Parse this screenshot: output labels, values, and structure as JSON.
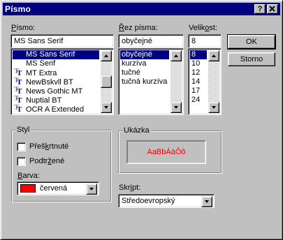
{
  "window": {
    "title": "Písmo",
    "help_button": "?",
    "close_button": "✕"
  },
  "font": {
    "label_u": "P",
    "label_rest": "ísmo:",
    "value": "MS Sans Serif",
    "items": [
      {
        "label": "MS Sans Serif",
        "icon": "none",
        "selected": true
      },
      {
        "label": "MS Serif",
        "icon": "none",
        "selected": false
      },
      {
        "label": "MT Extra",
        "icon": "truetype-icon",
        "selected": false
      },
      {
        "label": "NewBskvll BT",
        "icon": "truetype-icon",
        "selected": false
      },
      {
        "label": "News Gothic MT",
        "icon": "truetype-icon",
        "selected": false
      },
      {
        "label": "Nuptial BT",
        "icon": "truetype-icon",
        "selected": false
      },
      {
        "label": "OCR A Extended",
        "icon": "truetype-icon",
        "selected": false
      }
    ]
  },
  "style": {
    "label_u": "Ř",
    "label_rest": "ez písma:",
    "value": "obyčejné",
    "items": [
      {
        "label": "obyčejné",
        "selected": true
      },
      {
        "label": "kurzíva",
        "selected": false
      },
      {
        "label": "tučné",
        "selected": false
      },
      {
        "label": "tučná kurzíva",
        "selected": false
      }
    ]
  },
  "size": {
    "label_rest": "Velikost:",
    "value": "8",
    "items": [
      {
        "label": "8",
        "selected": true
      },
      {
        "label": "10",
        "selected": false
      },
      {
        "label": "12",
        "selected": false
      },
      {
        "label": "14",
        "selected": false
      },
      {
        "label": "17",
        "selected": false
      },
      {
        "label": "24",
        "selected": false
      }
    ]
  },
  "buttons": {
    "ok": "OK",
    "cancel": "Storno"
  },
  "effects": {
    "legend": "Styl",
    "strikeout_pre": "Přeš",
    "strikeout_u": "k",
    "strikeout_post": "rtnuté",
    "strikeout_checked": false,
    "underline_pre": "Podtr",
    "underline_u": "ž",
    "underline_post": "ené",
    "underline_checked": false,
    "color_label_u": "B",
    "color_label_rest": "arva:",
    "color_value": "červená",
    "color_swatch": "#ff0000"
  },
  "sample": {
    "legend": "Ukázka",
    "text": "AaBbÁáÔô",
    "text_color": "#ff0000"
  },
  "script": {
    "label_pre": "Skr",
    "label_u": "i",
    "label_post": "pt:",
    "value": "Středoevropský"
  },
  "colors": {
    "titlebar": "#000080",
    "face": "#c0c0c0",
    "selection": "#000080"
  }
}
